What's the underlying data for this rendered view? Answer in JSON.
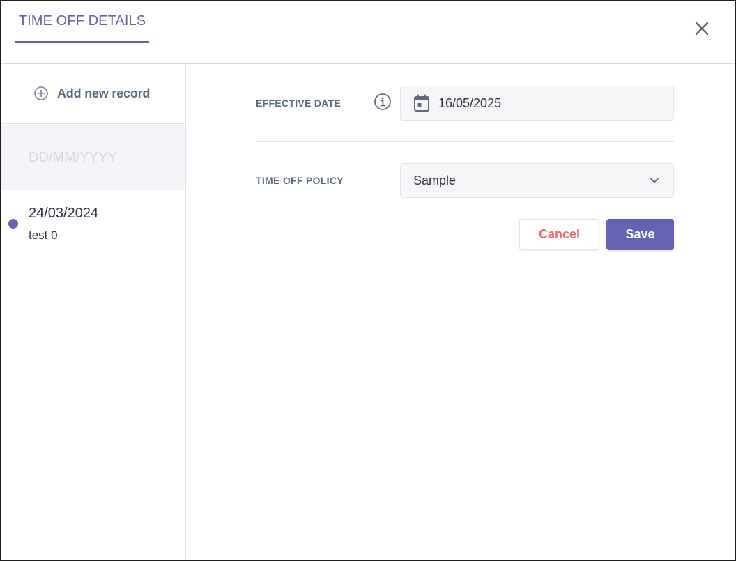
{
  "header": {
    "title": "TIME OFF DETAILS",
    "close_icon": "close-icon"
  },
  "sidebar": {
    "add_record_label": "Add new record",
    "add_icon": "plus-circle-icon",
    "draft_placeholder": "DD/MM/YYYY",
    "records": [
      {
        "date": "24/03/2024",
        "name": "test 0"
      }
    ]
  },
  "form": {
    "effective_date": {
      "label": "EFFECTIVE DATE",
      "value": "16/05/2025",
      "info_icon": "info-icon",
      "calendar_icon": "calendar-icon"
    },
    "time_off_policy": {
      "label": "TIME OFF POLICY",
      "value": "Sample",
      "chevron_icon": "chevron-down-icon"
    },
    "cancel_label": "Cancel",
    "save_label": "Save"
  },
  "colors": {
    "accent": "#6562b4",
    "cancel_text": "#ef6b6b",
    "label_text": "#5a6a80",
    "input_bg": "#f6f6f9"
  }
}
